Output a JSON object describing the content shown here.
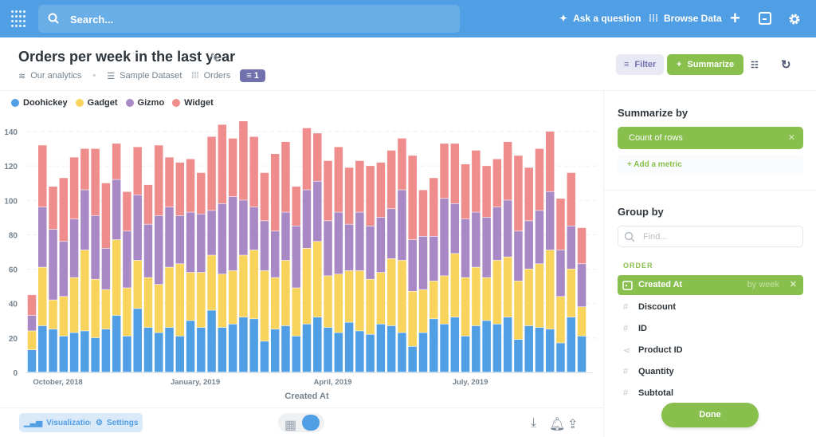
{
  "header": {
    "search_placeholder": "Search...",
    "ask_label": "Ask a question",
    "browse_label": "Browse Data",
    "icons": [
      "metabase-logo-icon",
      "search-icon",
      "sparkle-icon",
      "grid-icon",
      "plus-icon",
      "terminal-icon",
      "gear-icon"
    ],
    "color": "#509ee3"
  },
  "question": {
    "title": "Orders per week in the last year",
    "breadcrumbs": [
      "Our analytics",
      "Sample Dataset",
      "Orders"
    ],
    "filter_count": "1",
    "filter_label": "Filter",
    "summarize_label": "Summarize"
  },
  "sidebar": {
    "summarize_heading": "Summarize by",
    "metric": "Count of rows",
    "add_metric": "Add a metric",
    "group_heading": "Group by",
    "find_placeholder": "Find...",
    "section": "ORDER",
    "selected": {
      "label": "Created At",
      "bucket": "by week"
    },
    "fields": [
      {
        "label": "Discount",
        "icon": "hash-icon"
      },
      {
        "label": "ID",
        "icon": "hash-icon"
      },
      {
        "label": "Product ID",
        "icon": "connection-icon"
      },
      {
        "label": "Quantity",
        "icon": "hash-icon"
      },
      {
        "label": "Subtotal",
        "icon": "hash-icon"
      }
    ],
    "done_label": "Done",
    "accent": "#88bf4d"
  },
  "footer": {
    "visualization_label": "Visualization",
    "settings_label": "Settings",
    "active_view": "chart"
  },
  "chart_data": {
    "type": "bar",
    "stacked": true,
    "xlabel": "Created At",
    "ylabel": "",
    "ylim": [
      0,
      140
    ],
    "yticks": [
      0,
      20,
      40,
      60,
      80,
      100,
      120,
      140
    ],
    "grid": true,
    "legend": "top-left",
    "x_ticks": [
      {
        "label": "October, 2018",
        "date": "2018-10-01"
      },
      {
        "label": "January, 2019",
        "date": "2019-01-01"
      },
      {
        "label": "April, 2019",
        "date": "2019-04-01"
      },
      {
        "label": "July, 2019",
        "date": "2019-07-01"
      }
    ],
    "categories": [
      "2018-09-16",
      "2018-09-23",
      "2018-09-30",
      "2018-10-07",
      "2018-10-14",
      "2018-10-21",
      "2018-10-28",
      "2018-11-04",
      "2018-11-11",
      "2018-11-18",
      "2018-11-25",
      "2018-12-02",
      "2018-12-09",
      "2018-12-16",
      "2018-12-23",
      "2018-12-30",
      "2019-01-06",
      "2019-01-13",
      "2019-01-20",
      "2019-01-27",
      "2019-02-03",
      "2019-02-10",
      "2019-02-17",
      "2019-02-24",
      "2019-03-03",
      "2019-03-10",
      "2019-03-17",
      "2019-03-24",
      "2019-03-31",
      "2019-04-07",
      "2019-04-14",
      "2019-04-21",
      "2019-04-28",
      "2019-05-05",
      "2019-05-12",
      "2019-05-19",
      "2019-05-26",
      "2019-06-02",
      "2019-06-09",
      "2019-06-16",
      "2019-06-23",
      "2019-06-30",
      "2019-07-07",
      "2019-07-14",
      "2019-07-21",
      "2019-07-28",
      "2019-08-04",
      "2019-08-11",
      "2019-08-18",
      "2019-08-25",
      "2019-09-01",
      "2019-09-08",
      "2019-09-15"
    ],
    "series": [
      {
        "name": "Doohickey",
        "color": "#509ee3",
        "values": [
          13,
          27,
          25,
          21,
          23,
          24,
          20,
          25,
          33,
          21,
          37,
          26,
          23,
          26,
          21,
          30,
          26,
          36,
          26,
          28,
          32,
          31,
          18,
          25,
          27,
          21,
          28,
          32,
          26,
          23,
          29,
          24,
          22,
          28,
          27,
          23,
          15,
          23,
          31,
          28,
          32,
          21,
          27,
          30,
          28,
          32,
          19,
          27,
          26,
          25,
          17,
          32,
          21
        ]
      },
      {
        "name": "Gadget",
        "color": "#f9d45c",
        "values": [
          11,
          34,
          17,
          23,
          32,
          47,
          34,
          23,
          44,
          28,
          28,
          29,
          28,
          35,
          42,
          28,
          32,
          32,
          31,
          31,
          36,
          40,
          41,
          30,
          38,
          28,
          44,
          44,
          30,
          34,
          30,
          35,
          32,
          30,
          39,
          42,
          32,
          25,
          22,
          28,
          37,
          34,
          34,
          25,
          37,
          35,
          34,
          33,
          37,
          46,
          27,
          28,
          17
        ]
      },
      {
        "name": "Gizmo",
        "color": "#a989c5",
        "values": [
          9,
          35,
          41,
          32,
          34,
          35,
          37,
          24,
          35,
          33,
          38,
          31,
          40,
          35,
          28,
          35,
          34,
          26,
          41,
          43,
          32,
          25,
          29,
          27,
          28,
          36,
          34,
          35,
          32,
          36,
          27,
          34,
          31,
          32,
          29,
          41,
          30,
          31,
          26,
          45,
          29,
          34,
          32,
          35,
          31,
          33,
          29,
          28,
          31,
          34,
          27,
          25,
          25
        ]
      },
      {
        "name": "Widget",
        "color": "#ef8c8c",
        "values": [
          12,
          36,
          25,
          37,
          36,
          24,
          39,
          38,
          21,
          23,
          28,
          23,
          41,
          29,
          31,
          31,
          24,
          43,
          46,
          34,
          46,
          41,
          28,
          45,
          41,
          23,
          36,
          28,
          35,
          38,
          33,
          30,
          35,
          32,
          34,
          30,
          49,
          27,
          34,
          32,
          35,
          32,
          36,
          30,
          28,
          34,
          44,
          31,
          36,
          35,
          30,
          31,
          21
        ]
      }
    ]
  }
}
